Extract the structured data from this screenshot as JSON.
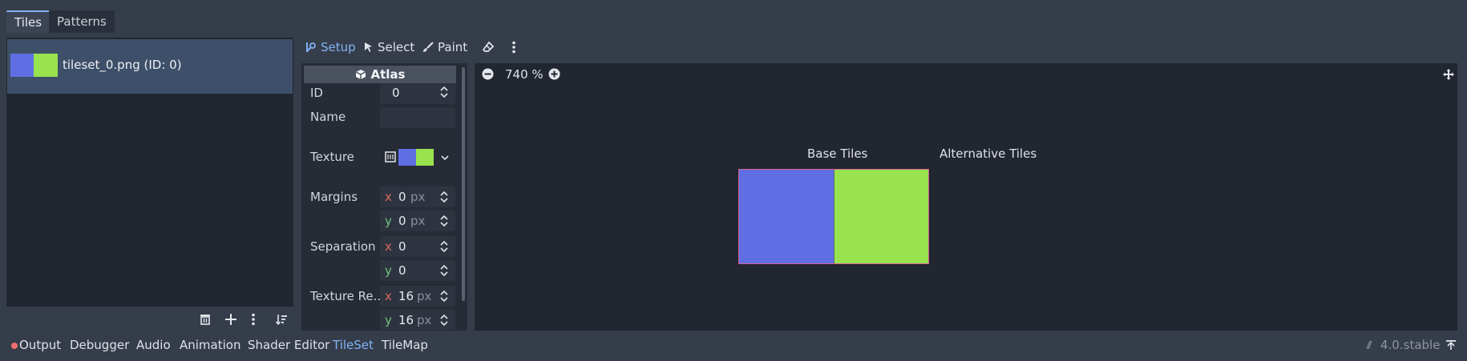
{
  "top_tabs": [
    {
      "label": "Tiles",
      "active": true
    },
    {
      "label": "Patterns",
      "active": false
    }
  ],
  "sources": [
    {
      "label": "tileset_0.png (ID: 0)",
      "thumb_colors": [
        "#5f6fe3",
        "#98e34e"
      ]
    }
  ],
  "source_toolbar_icons": [
    "trash-icon",
    "plus-icon",
    "kebab-menu-icon",
    "sort-icon"
  ],
  "toolbar": {
    "setup": "Setup",
    "select": "Select",
    "paint": "Paint",
    "icons": [
      "eraser-icon",
      "kebab-menu-icon"
    ]
  },
  "inspector": {
    "header": "Atlas",
    "id_label": "ID",
    "id_value": "0",
    "name_label": "Name",
    "name_value": "",
    "texture_label": "Texture",
    "margins_label": "Margins",
    "margins": {
      "x": "0",
      "y": "0",
      "unit": "px"
    },
    "separation_label": "Separation",
    "separation": {
      "x": "0",
      "y": "0"
    },
    "texture_region_label": "Texture Re...",
    "texture_region": {
      "x": "16",
      "y": "16",
      "unit": "px"
    },
    "axis_x": "x",
    "axis_y": "y"
  },
  "viewport": {
    "zoom": "740 %",
    "base_tiles_label": "Base Tiles",
    "alternative_tiles_label": "Alternative Tiles",
    "tile_colors": [
      "#5f6fe3",
      "#98e34e"
    ]
  },
  "bottom_tabs": [
    {
      "label": "Output",
      "active": false
    },
    {
      "label": "Debugger",
      "active": false
    },
    {
      "label": "Audio",
      "active": false
    },
    {
      "label": "Animation",
      "active": false
    },
    {
      "label": "Shader Editor",
      "active": false
    },
    {
      "label": "TileSet",
      "active": true
    },
    {
      "label": "TileMap",
      "active": false
    }
  ],
  "version": "4.0.stable",
  "colors": {
    "accent": "#7fb4f5",
    "background": "#363d4a",
    "panel": "#212630",
    "selected_item": "#3e5069",
    "axis_x": "#d66a5e",
    "axis_y": "#72c37f",
    "error_dot": "#f26d6d"
  }
}
